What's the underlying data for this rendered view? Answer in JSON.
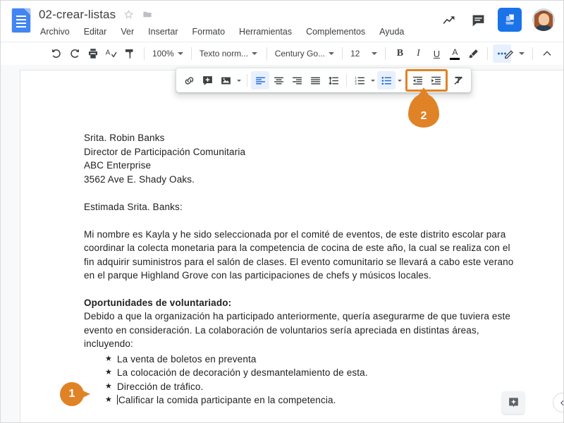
{
  "header": {
    "doc_title": "02-crear-listas",
    "star_icon": "star-outline-icon",
    "folder_icon": "folder-icon",
    "menu": [
      {
        "label": "Archivo"
      },
      {
        "label": "Editar"
      },
      {
        "label": "Ver"
      },
      {
        "label": "Insertar"
      },
      {
        "label": "Formato"
      },
      {
        "label": "Herramientas"
      },
      {
        "label": "Complementos"
      },
      {
        "label": "Ayuda"
      }
    ],
    "right_icons": [
      {
        "name": "activity-dashboard-icon"
      },
      {
        "name": "comment-history-icon"
      },
      {
        "name": "share-button",
        "color": "#1a73e8"
      },
      {
        "name": "user-avatar"
      }
    ]
  },
  "toolbar": {
    "undo": "undo-icon",
    "redo": "redo-icon",
    "print": "print-icon",
    "spellcheck": "spellcheck-icon",
    "paint_format": "paint-format-icon",
    "zoom_value": "100%",
    "style_value": "Texto norm...",
    "font_value": "Century Go...",
    "size_value": "12",
    "bold_label": "B",
    "italic_label": "I",
    "underline_label": "U",
    "text_color_label": "A",
    "highlight": "highlighter-icon",
    "more": "more-options-icon",
    "edit_mode": "edit-pencil-icon",
    "collapse": "collapse-chevron-icon"
  },
  "overflow_toolbar": {
    "link": "insert-link-icon",
    "comment": "add-comment-icon",
    "image": "insert-image-icon",
    "align_left": "align-left-icon",
    "align_center": "align-center-icon",
    "align_right": "align-right-icon",
    "align_justify": "align-justify-icon",
    "line_spacing": "line-spacing-icon",
    "numbered_list": "numbered-list-icon",
    "bulleted_list": "bulleted-list-icon",
    "decrease_indent": "decrease-indent-icon",
    "increase_indent": "increase-indent-icon",
    "clear_formatting": "clear-formatting-icon",
    "highlight_color": "#e08326"
  },
  "document": {
    "address": [
      "Srita. Robin Banks",
      "Director de Participación Comunitaria",
      "ABC Enterprise",
      "3562 Ave E. Shady Oaks."
    ],
    "salutation": "Estimada Srita. Banks:",
    "paragraph1": "Mi nombre es Kayla y he sido seleccionada por el comité de eventos, de este distrito escolar para coordinar la colecta monetaria para la competencia de cocina de este año, la cual se realiza con el fin adquirir suministros para el salón de clases. El evento comunitario se llevará a cabo este verano en el parque Highland Grove con las participaciones de chefs y músicos locales.",
    "heading": "Oportunidades de voluntariado:",
    "paragraph2": "Debido a que la organización ha participado anteriormente, quería asegurarme de que tuviera este evento en consideración. La colaboración de voluntarios sería apreciada en distintas áreas, incluyendo:",
    "bullet_glyph": "★",
    "list_items": [
      "La venta de boletos en preventa",
      "La colocación de decoración y desmantelamiento de esta.",
      "Dirección de tráfico.",
      "Calificar la comida participante en la competencia."
    ]
  },
  "floating": {
    "explore": "explore-icon",
    "collapse_panel": "collapse-panel-chevron-icon"
  },
  "annotations": [
    {
      "number": "1",
      "target": "last-list-item"
    },
    {
      "number": "2",
      "target": "indent-buttons"
    }
  ]
}
